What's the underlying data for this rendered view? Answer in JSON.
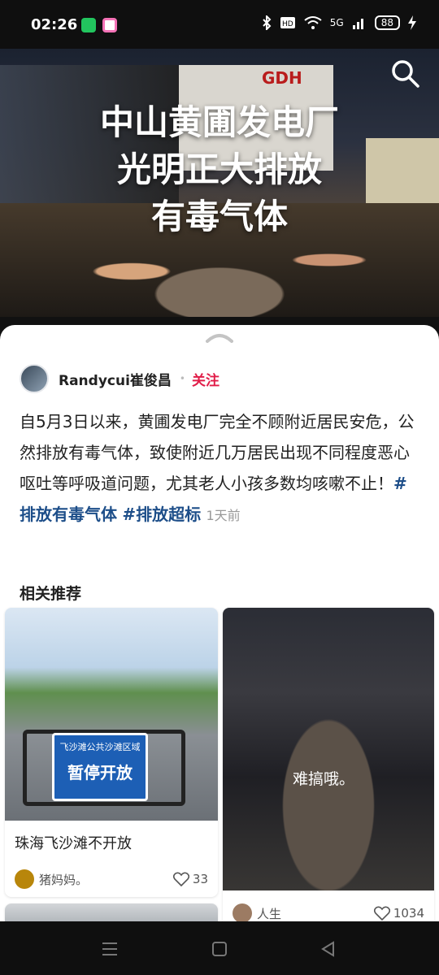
{
  "status_bar": {
    "time": "02:26",
    "network": "5G",
    "battery": "88"
  },
  "hero": {
    "headline_lines": [
      "中山黄圃发电厂",
      "光明正大排放",
      "有毒气体"
    ],
    "building_sign": "GDH",
    "search_icon": "search-icon"
  },
  "post": {
    "author_name": "Randycui崔俊昌",
    "follow_label": "关注",
    "text": "自5月3日以来，黄圃发电厂完全不顾附近居民安危，公然排放有毒气体，致使附近几万居民出现不同程度恶心呕吐等呼吸道问题，尤其老人小孩多数均咳嗽不止！",
    "tags": [
      "#排放有毒气体",
      "#排放超标"
    ],
    "time_ago": "1天前"
  },
  "related": {
    "title": "相关推荐",
    "cards": [
      {
        "caption": "珠海飞沙滩不开放",
        "author": "猪妈妈。",
        "likes": "33",
        "sign_line1": "飞沙滩公共沙滩区域",
        "sign_line2": "暂停开放"
      },
      {
        "overlay_text": "难搞哦。",
        "author": "人生",
        "likes": "1034"
      }
    ]
  },
  "colors": {
    "accent": "#e11d48",
    "tag": "#1d4e89"
  }
}
